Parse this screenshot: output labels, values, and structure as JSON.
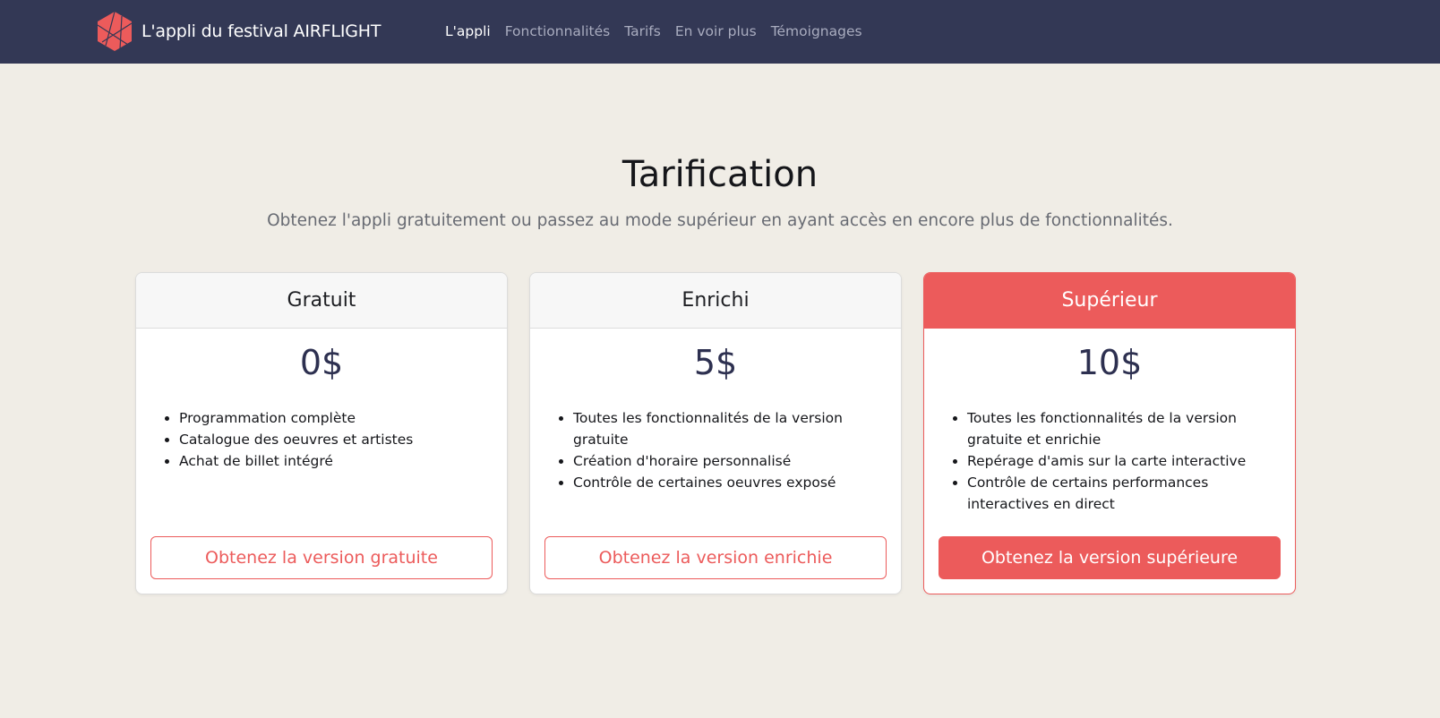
{
  "navbar": {
    "brand": "L'appli du festival AIRFLIGHT",
    "links": [
      {
        "label": "L'appli",
        "active": true
      },
      {
        "label": "Fonctionnalités",
        "active": false
      },
      {
        "label": "Tarifs",
        "active": false
      },
      {
        "label": "En voir plus",
        "active": false
      },
      {
        "label": "Témoignages",
        "active": false
      }
    ]
  },
  "pricing": {
    "title": "Tarification",
    "subtitle": "Obtenez l'appli gratuitement ou passez au mode supérieur en ayant accès en encore plus de fonctionnalités.",
    "plans": [
      {
        "name": "Gratuit",
        "price": "0$",
        "features": [
          "Programmation complète",
          "Catalogue des oeuvres et artistes",
          "Achat de billet intégré"
        ],
        "cta": "Obtenez la version gratuite"
      },
      {
        "name": "Enrichi",
        "price": "5$",
        "features": [
          "Toutes les fonctionnalités de la version gratuite",
          "Création d'horaire personnalisé",
          "Contrôle de certaines oeuvres exposé"
        ],
        "cta": "Obtenez la version enrichie"
      },
      {
        "name": "Supérieur",
        "price": "10$",
        "features": [
          "Toutes les fonctionnalités de la version gratuite et enrichie",
          "Repérage d'amis sur la carte interactive",
          "Contrôle de certains performances interactives en direct"
        ],
        "cta": "Obtenez la version supérieure"
      }
    ]
  },
  "colors": {
    "navbar_bg": "#333855",
    "page_bg": "#f0ede6",
    "accent": "#ec5b5b",
    "price_text": "#2d3050"
  },
  "icons": {
    "logo": "geometric-hexagon-icon"
  }
}
